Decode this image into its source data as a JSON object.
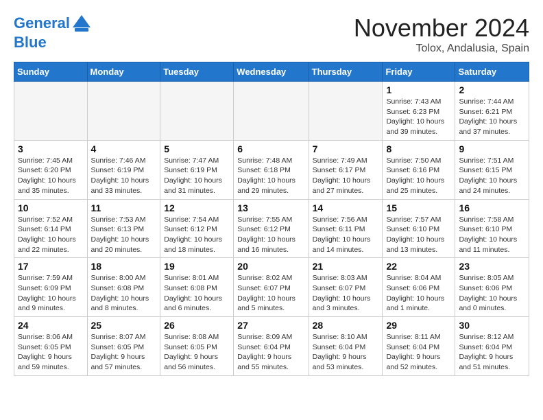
{
  "header": {
    "logo_line1": "General",
    "logo_line2": "Blue",
    "month_title": "November 2024",
    "location": "Tolox, Andalusia, Spain"
  },
  "weekdays": [
    "Sunday",
    "Monday",
    "Tuesday",
    "Wednesday",
    "Thursday",
    "Friday",
    "Saturday"
  ],
  "weeks": [
    [
      {
        "day": "",
        "info": ""
      },
      {
        "day": "",
        "info": ""
      },
      {
        "day": "",
        "info": ""
      },
      {
        "day": "",
        "info": ""
      },
      {
        "day": "",
        "info": ""
      },
      {
        "day": "1",
        "info": "Sunrise: 7:43 AM\nSunset: 6:23 PM\nDaylight: 10 hours\nand 39 minutes."
      },
      {
        "day": "2",
        "info": "Sunrise: 7:44 AM\nSunset: 6:21 PM\nDaylight: 10 hours\nand 37 minutes."
      }
    ],
    [
      {
        "day": "3",
        "info": "Sunrise: 7:45 AM\nSunset: 6:20 PM\nDaylight: 10 hours\nand 35 minutes."
      },
      {
        "day": "4",
        "info": "Sunrise: 7:46 AM\nSunset: 6:19 PM\nDaylight: 10 hours\nand 33 minutes."
      },
      {
        "day": "5",
        "info": "Sunrise: 7:47 AM\nSunset: 6:19 PM\nDaylight: 10 hours\nand 31 minutes."
      },
      {
        "day": "6",
        "info": "Sunrise: 7:48 AM\nSunset: 6:18 PM\nDaylight: 10 hours\nand 29 minutes."
      },
      {
        "day": "7",
        "info": "Sunrise: 7:49 AM\nSunset: 6:17 PM\nDaylight: 10 hours\nand 27 minutes."
      },
      {
        "day": "8",
        "info": "Sunrise: 7:50 AM\nSunset: 6:16 PM\nDaylight: 10 hours\nand 25 minutes."
      },
      {
        "day": "9",
        "info": "Sunrise: 7:51 AM\nSunset: 6:15 PM\nDaylight: 10 hours\nand 24 minutes."
      }
    ],
    [
      {
        "day": "10",
        "info": "Sunrise: 7:52 AM\nSunset: 6:14 PM\nDaylight: 10 hours\nand 22 minutes."
      },
      {
        "day": "11",
        "info": "Sunrise: 7:53 AM\nSunset: 6:13 PM\nDaylight: 10 hours\nand 20 minutes."
      },
      {
        "day": "12",
        "info": "Sunrise: 7:54 AM\nSunset: 6:12 PM\nDaylight: 10 hours\nand 18 minutes."
      },
      {
        "day": "13",
        "info": "Sunrise: 7:55 AM\nSunset: 6:12 PM\nDaylight: 10 hours\nand 16 minutes."
      },
      {
        "day": "14",
        "info": "Sunrise: 7:56 AM\nSunset: 6:11 PM\nDaylight: 10 hours\nand 14 minutes."
      },
      {
        "day": "15",
        "info": "Sunrise: 7:57 AM\nSunset: 6:10 PM\nDaylight: 10 hours\nand 13 minutes."
      },
      {
        "day": "16",
        "info": "Sunrise: 7:58 AM\nSunset: 6:10 PM\nDaylight: 10 hours\nand 11 minutes."
      }
    ],
    [
      {
        "day": "17",
        "info": "Sunrise: 7:59 AM\nSunset: 6:09 PM\nDaylight: 10 hours\nand 9 minutes."
      },
      {
        "day": "18",
        "info": "Sunrise: 8:00 AM\nSunset: 6:08 PM\nDaylight: 10 hours\nand 8 minutes."
      },
      {
        "day": "19",
        "info": "Sunrise: 8:01 AM\nSunset: 6:08 PM\nDaylight: 10 hours\nand 6 minutes."
      },
      {
        "day": "20",
        "info": "Sunrise: 8:02 AM\nSunset: 6:07 PM\nDaylight: 10 hours\nand 5 minutes."
      },
      {
        "day": "21",
        "info": "Sunrise: 8:03 AM\nSunset: 6:07 PM\nDaylight: 10 hours\nand 3 minutes."
      },
      {
        "day": "22",
        "info": "Sunrise: 8:04 AM\nSunset: 6:06 PM\nDaylight: 10 hours\nand 1 minute."
      },
      {
        "day": "23",
        "info": "Sunrise: 8:05 AM\nSunset: 6:06 PM\nDaylight: 10 hours\nand 0 minutes."
      }
    ],
    [
      {
        "day": "24",
        "info": "Sunrise: 8:06 AM\nSunset: 6:05 PM\nDaylight: 9 hours\nand 59 minutes."
      },
      {
        "day": "25",
        "info": "Sunrise: 8:07 AM\nSunset: 6:05 PM\nDaylight: 9 hours\nand 57 minutes."
      },
      {
        "day": "26",
        "info": "Sunrise: 8:08 AM\nSunset: 6:05 PM\nDaylight: 9 hours\nand 56 minutes."
      },
      {
        "day": "27",
        "info": "Sunrise: 8:09 AM\nSunset: 6:04 PM\nDaylight: 9 hours\nand 55 minutes."
      },
      {
        "day": "28",
        "info": "Sunrise: 8:10 AM\nSunset: 6:04 PM\nDaylight: 9 hours\nand 53 minutes."
      },
      {
        "day": "29",
        "info": "Sunrise: 8:11 AM\nSunset: 6:04 PM\nDaylight: 9 hours\nand 52 minutes."
      },
      {
        "day": "30",
        "info": "Sunrise: 8:12 AM\nSunset: 6:04 PM\nDaylight: 9 hours\nand 51 minutes."
      }
    ]
  ]
}
